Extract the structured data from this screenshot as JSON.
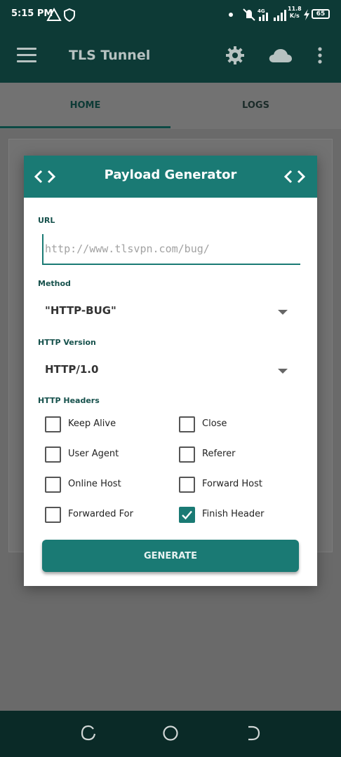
{
  "status_bar": {
    "time": "5:15 PM",
    "network_speed_value": "11.8",
    "network_speed_unit": "K/s",
    "battery": "65"
  },
  "app_bar": {
    "title": "TLS Tunnel"
  },
  "tabs": [
    {
      "label": "HOME",
      "selected": true
    },
    {
      "label": "LOGS",
      "selected": false
    }
  ],
  "dialog": {
    "title": "Payload Generator",
    "url_label": "URL",
    "url_placeholder": "http://www.tlsvpn.com/bug/",
    "method_label": "Method",
    "method_value": "\"HTTP-BUG\"",
    "http_version_label": "HTTP Version",
    "http_version_value": "HTTP/1.0",
    "headers_label": "HTTP Headers",
    "headers": [
      {
        "label": "Keep Alive",
        "checked": false
      },
      {
        "label": "Close",
        "checked": false
      },
      {
        "label": "User Agent",
        "checked": false
      },
      {
        "label": "Referer",
        "checked": false
      },
      {
        "label": "Online Host",
        "checked": false
      },
      {
        "label": "Forward Host",
        "checked": false
      },
      {
        "label": "Forwarded For",
        "checked": false
      },
      {
        "label": "Finish Header",
        "checked": true
      }
    ],
    "generate_label": "GENERATE"
  },
  "colors": {
    "app_bar": "#0d3a36",
    "accent": "#1a7a74",
    "label_text": "#16514c"
  },
  "icons": {
    "status_bar": [
      "warning-triangle-icon",
      "shield-icon",
      "dot-icon",
      "mute-icon",
      "signal-4g-icon",
      "signal-icon",
      "charging-bolt-icon",
      "battery-icon"
    ],
    "app_bar": [
      "menu-icon",
      "gear-icon",
      "cloud-icon",
      "more-vert-icon"
    ],
    "dialog_header": [
      "code-brackets-icon",
      "code-brackets-icon"
    ],
    "nav_bar": [
      "recent-apps-icon",
      "home-circle-icon",
      "back-icon"
    ]
  }
}
